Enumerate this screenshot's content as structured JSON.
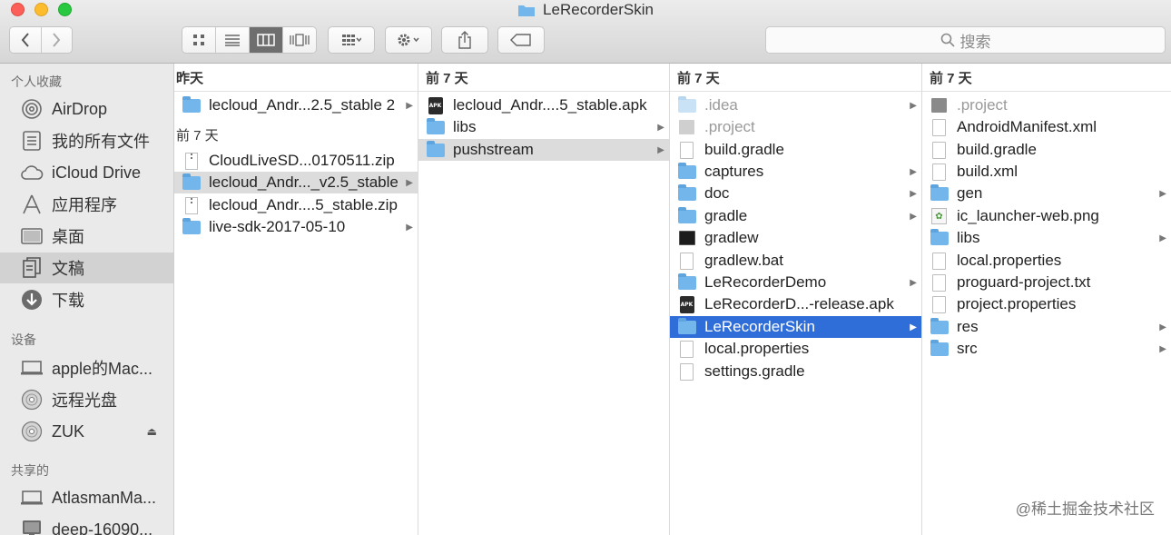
{
  "window": {
    "title": "LeRecorderSkin"
  },
  "toolbar": {
    "search_placeholder": "搜索"
  },
  "sidebar": {
    "sections": [
      {
        "label": "个人收藏"
      },
      {
        "label": "设备"
      },
      {
        "label": "共享的"
      }
    ],
    "favorites": [
      {
        "label": "AirDrop",
        "icon": "airdrop-icon"
      },
      {
        "label": "我的所有文件",
        "icon": "all-files-icon"
      },
      {
        "label": "iCloud Drive",
        "icon": "cloud-icon"
      },
      {
        "label": "应用程序",
        "icon": "applications-icon"
      },
      {
        "label": "桌面",
        "icon": "desktop-icon"
      },
      {
        "label": "文稿",
        "icon": "documents-icon"
      },
      {
        "label": "下载",
        "icon": "downloads-icon"
      }
    ],
    "devices": [
      {
        "label": "apple的Mac...",
        "icon": "laptop-icon"
      },
      {
        "label": "远程光盘",
        "icon": "disc-icon"
      },
      {
        "label": "ZUK",
        "icon": "disc-icon"
      }
    ],
    "shared": [
      {
        "label": "AtlasmanMa...",
        "icon": "laptop-icon"
      },
      {
        "label": "deep-16090...",
        "icon": "monitor-icon"
      }
    ]
  },
  "columns": [
    {
      "header": "昨天",
      "group_label": "前 7 天",
      "items": [
        {
          "label": "lecloud_Andr...2.5_stable 2",
          "icon": "folder"
        },
        {
          "label": "CloudLiveSD...0170511.zip",
          "icon": "zip"
        },
        {
          "label": "lecloud_Andr..._v2.5_stable",
          "icon": "folder"
        },
        {
          "label": "lecloud_Andr....5_stable.zip",
          "icon": "zip"
        },
        {
          "label": "live-sdk-2017-05-10",
          "icon": "folder"
        }
      ]
    },
    {
      "header": "前 7 天",
      "items": [
        {
          "label": "lecloud_Andr....5_stable.apk",
          "icon": "apk"
        },
        {
          "label": "libs",
          "icon": "folder"
        },
        {
          "label": "pushstream",
          "icon": "folder"
        }
      ]
    },
    {
      "header": "前 7 天",
      "items": [
        {
          "label": ".idea",
          "icon": "folder-light"
        },
        {
          "label": ".project",
          "icon": "gray-doc"
        },
        {
          "label": "build.gradle",
          "icon": "doc"
        },
        {
          "label": "captures",
          "icon": "folder"
        },
        {
          "label": "doc",
          "icon": "folder"
        },
        {
          "label": "gradle",
          "icon": "folder"
        },
        {
          "label": "gradlew",
          "icon": "terminal"
        },
        {
          "label": "gradlew.bat",
          "icon": "doc"
        },
        {
          "label": "LeRecorderDemo",
          "icon": "folder"
        },
        {
          "label": "LeRecorderD...-release.apk",
          "icon": "apk"
        },
        {
          "label": "LeRecorderSkin",
          "icon": "folder"
        },
        {
          "label": "local.properties",
          "icon": "doc"
        },
        {
          "label": "settings.gradle",
          "icon": "doc"
        }
      ]
    },
    {
      "header": "前 7 天",
      "items": [
        {
          "label": ".project",
          "icon": "gray-doc"
        },
        {
          "label": "AndroidManifest.xml",
          "icon": "doc"
        },
        {
          "label": "build.gradle",
          "icon": "doc"
        },
        {
          "label": "build.xml",
          "icon": "doc"
        },
        {
          "label": "gen",
          "icon": "folder"
        },
        {
          "label": "ic_launcher-web.png",
          "icon": "png"
        },
        {
          "label": "libs",
          "icon": "folder"
        },
        {
          "label": "local.properties",
          "icon": "doc"
        },
        {
          "label": "proguard-project.txt",
          "icon": "doc"
        },
        {
          "label": "project.properties",
          "icon": "doc"
        },
        {
          "label": "res",
          "icon": "folder"
        },
        {
          "label": "src",
          "icon": "folder"
        }
      ]
    }
  ],
  "apk_badge": "APK",
  "watermark": "@稀土掘金技术社区"
}
